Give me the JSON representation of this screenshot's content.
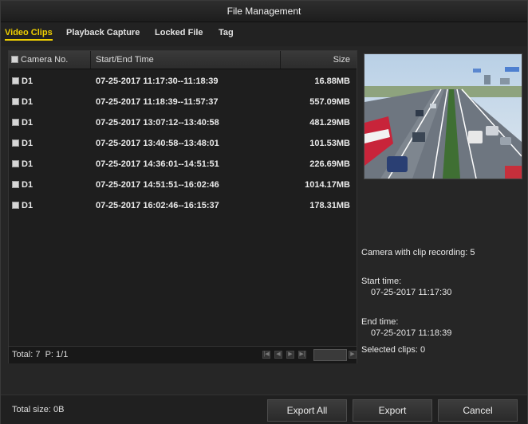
{
  "window": {
    "title": "File Management"
  },
  "tabs": [
    {
      "label": "Video Clips",
      "active": true
    },
    {
      "label": "Playback Capture",
      "active": false
    },
    {
      "label": "Locked File",
      "active": false
    },
    {
      "label": "Tag",
      "active": false
    }
  ],
  "table": {
    "columns": [
      "Camera No.",
      "Start/End Time",
      "Size"
    ],
    "rows": [
      {
        "camera": "D1",
        "time": "07-25-2017 11:17:30--11:18:39",
        "size": "16.88MB"
      },
      {
        "camera": "D1",
        "time": "07-25-2017 11:18:39--11:57:37",
        "size": "557.09MB"
      },
      {
        "camera": "D1",
        "time": "07-25-2017 13:07:12--13:40:58",
        "size": "481.29MB"
      },
      {
        "camera": "D1",
        "time": "07-25-2017 13:40:58--13:48:01",
        "size": "101.53MB"
      },
      {
        "camera": "D1",
        "time": "07-25-2017 14:36:01--14:51:51",
        "size": "226.69MB"
      },
      {
        "camera": "D1",
        "time": "07-25-2017 14:51:51--16:02:46",
        "size": "1014.17MB"
      },
      {
        "camera": "D1",
        "time": "07-25-2017 16:02:46--16:15:37",
        "size": "178.31MB"
      }
    ]
  },
  "pager": {
    "summary": "Total: 7  P: 1/1"
  },
  "info": {
    "camera_with_clip": "Camera with clip recording: 5",
    "start_label": "Start time:",
    "start_value": "07-25-2017 11:17:30",
    "end_label": "End time:",
    "end_value": "07-25-2017 11:18:39",
    "selected": "Selected clips: 0"
  },
  "footer": {
    "total_size": "Total size: 0B",
    "export_all": "Export All",
    "export": "Export",
    "cancel": "Cancel"
  },
  "icons": [
    "checkbox-icon",
    "first-page-icon",
    "prev-page-icon",
    "next-page-icon",
    "last-page-icon",
    "go-page-icon"
  ],
  "colors": {
    "active_tab": "#f0d000",
    "window_bg": "#262626"
  }
}
